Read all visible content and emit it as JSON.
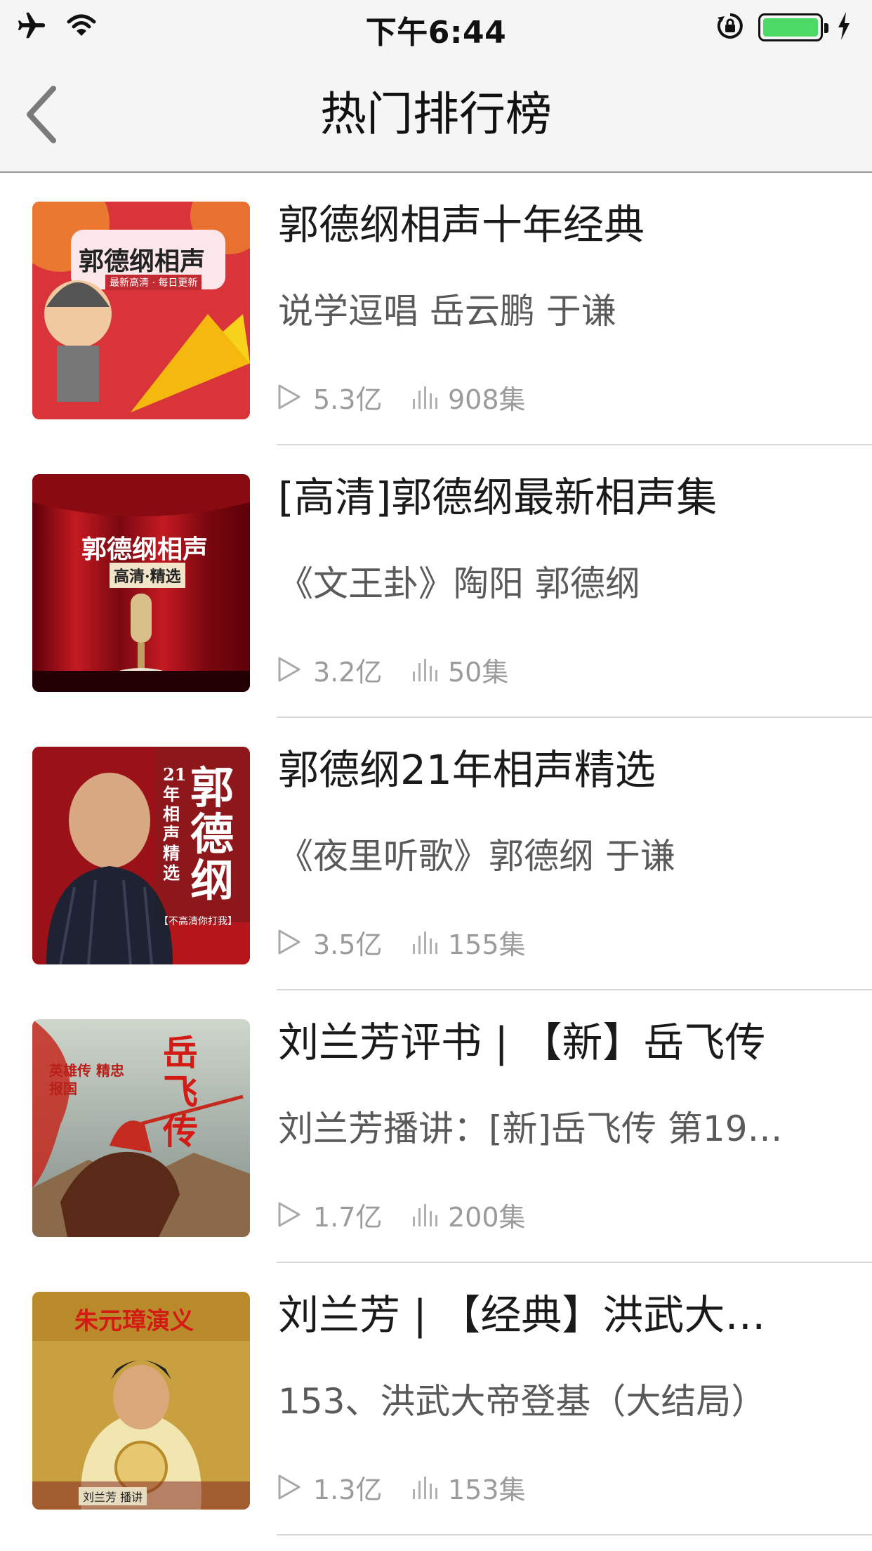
{
  "status_bar": {
    "time": "下午6:44",
    "battery_level": 1.0,
    "battery_color": "#4cd964",
    "icons": [
      "airplane-icon",
      "wifi-icon",
      "rotation-lock-icon",
      "battery-icon",
      "charging-bolt-icon"
    ]
  },
  "nav": {
    "title": "热门排行榜",
    "back_icon": "chevron-left-icon"
  },
  "items": [
    {
      "title": "郭德纲相声十年经典",
      "subtitle": "说学逗唱 岳云鹏 于谦",
      "plays": "5.3亿",
      "episodes": "908集",
      "cover_text": [
        "郭德纲相声",
        "最新高清 · 每日更新"
      ],
      "cover_color": "#d8343a"
    },
    {
      "title": "[高清]郭德纲最新相声集",
      "subtitle": "《文王卦》陶阳 郭德纲",
      "plays": "3.2亿",
      "episodes": "50集",
      "cover_text": [
        "郭德纲相声",
        "高清·精选"
      ],
      "cover_color": "#a0111a"
    },
    {
      "title": "郭德纲21年相声精选",
      "subtitle": "《夜里听歌》郭德纲 于谦",
      "plays": "3.5亿",
      "episodes": "155集",
      "cover_text": [
        "郭德纲",
        "21年相声精选",
        "【不高清你打我】"
      ],
      "cover_color": "#b5161c"
    },
    {
      "title": "刘兰芳评书 | 【新】岳飞传",
      "subtitle": "刘兰芳播讲：[新]岳飞传 第19…",
      "plays": "1.7亿",
      "episodes": "200集",
      "cover_text": [
        "岳飞传",
        "英雄传 精忠报国"
      ],
      "cover_color": "#8a9a8a"
    },
    {
      "title": "刘兰芳 | 【经典】洪武大…",
      "subtitle": "153、洪武大帝登基（大结局）",
      "plays": "1.3亿",
      "episodes": "153集",
      "cover_text": [
        "朱元璋演义",
        "刘兰芳 播讲"
      ],
      "cover_color": "#c9a040"
    }
  ]
}
